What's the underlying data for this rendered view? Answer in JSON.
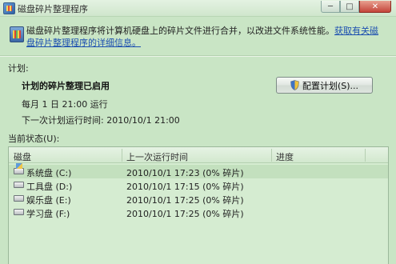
{
  "window": {
    "title": "磁盘碎片整理程序",
    "controls": {
      "minimize": "─",
      "maximize": "□",
      "close": "✕"
    }
  },
  "description": {
    "text": "磁盘碎片整理程序将计算机硬盘上的碎片文件进行合并，以改进文件系统性能。",
    "link": "获取有关磁盘碎片整理程序的详细信息。"
  },
  "schedule": {
    "section_label": "计划:",
    "status": "计划的碎片整理已启用",
    "frequency": "每月 1 日 21:00 运行",
    "next_run": "下一次计划运行时间: 2010/10/1 21:00",
    "configure_button": "配置计划(S)..."
  },
  "current_status": {
    "label": "当前状态(U):",
    "columns": [
      "磁盘",
      "上一次运行时间",
      "进度"
    ],
    "rows": [
      {
        "disk": "系统盘 (C:)",
        "last_run": "2010/10/1 17:23 (0% 碎片)",
        "progress": "",
        "icon": "system-drive-icon",
        "selected": true
      },
      {
        "disk": "工具盘 (D:)",
        "last_run": "2010/10/1 17:15 (0% 碎片)",
        "progress": "",
        "icon": "drive-icon",
        "selected": false
      },
      {
        "disk": "娱乐盘 (E:)",
        "last_run": "2010/10/1 17:25 (0% 碎片)",
        "progress": "",
        "icon": "drive-icon",
        "selected": false
      },
      {
        "disk": "学习盘 (F:)",
        "last_run": "2010/10/1 17:25 (0% 碎片)",
        "progress": "",
        "icon": "drive-icon",
        "selected": false
      }
    ]
  },
  "colors": {
    "background": "#c9e5c5",
    "link": "#1c4fb0",
    "close_button": "#c4453a"
  }
}
